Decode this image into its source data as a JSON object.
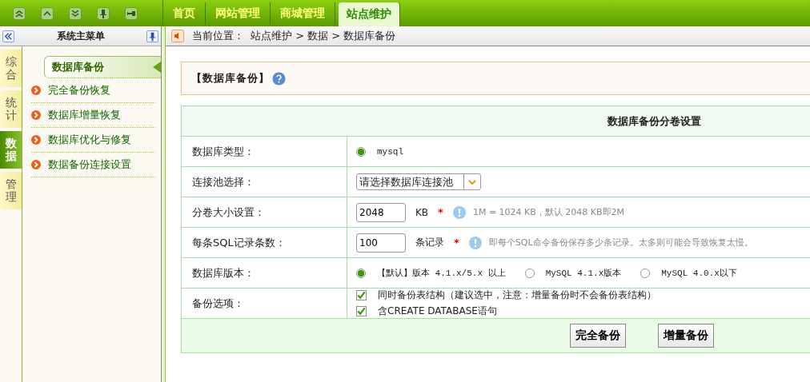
{
  "top_tabs": [
    {
      "label": "首页",
      "selected": false
    },
    {
      "label": "网站管理",
      "selected": false
    },
    {
      "label": "商城管理",
      "selected": false
    },
    {
      "label": "站点维护",
      "selected": true
    }
  ],
  "sidebar": {
    "title": "系统主菜单",
    "vtabs": [
      {
        "label": "综合",
        "selected": false
      },
      {
        "label": "统计",
        "selected": false
      },
      {
        "label": "数据",
        "selected": true
      },
      {
        "label": "管理",
        "selected": false
      }
    ],
    "section": "数据库备份",
    "items": [
      {
        "label": "完全备份恢复"
      },
      {
        "label": "数据库增量恢复"
      },
      {
        "label": "数据库优化与修复"
      },
      {
        "label": "数据备份连接设置"
      }
    ]
  },
  "breadcrumb": {
    "label": "当前位置：",
    "path": "站点维护 > 数据 > 数据库备份"
  },
  "panel_title": "【数据库备份】",
  "form": {
    "heading": "数据库备份分卷设置",
    "rows": [
      {
        "label": "数据库类型：",
        "kind": "radio",
        "options": [
          {
            "label": "mysql",
            "selected": true
          }
        ]
      },
      {
        "label": "连接池选择：",
        "kind": "select",
        "value": "请选择数据库连接池"
      },
      {
        "label": "分卷大小设置：",
        "kind": "input",
        "value": "2048",
        "unit": "KB",
        "required_mark": "*",
        "hint": "1M = 1024 KB，默认 2048 KB即2M"
      },
      {
        "label": "每条SQL记录条数：",
        "kind": "input",
        "value": "100",
        "unit": "条记录",
        "required_mark": "*",
        "hint": "即每个SQL命令备份保存多少条记录。太多则可能会导致恢复太慢。"
      },
      {
        "label": "数据库版本：",
        "kind": "radio",
        "options": [
          {
            "label": "【默认】版本 4.1.x/5.x 以上",
            "selected": true
          },
          {
            "label": "MySQL 4.1.x版本",
            "selected": false
          },
          {
            "label": "MySQL 4.0.x以下",
            "selected": false
          }
        ]
      },
      {
        "label": "备份选项：",
        "kind": "checkbox",
        "options": [
          {
            "label": "同时备份表结构（建议选中，注意：增量备份时不会备份表结构）",
            "checked": true
          },
          {
            "label": "含CREATE DATABASE语句",
            "checked": true
          }
        ]
      }
    ],
    "buttons": [
      "完全备份",
      "增量备份"
    ]
  }
}
